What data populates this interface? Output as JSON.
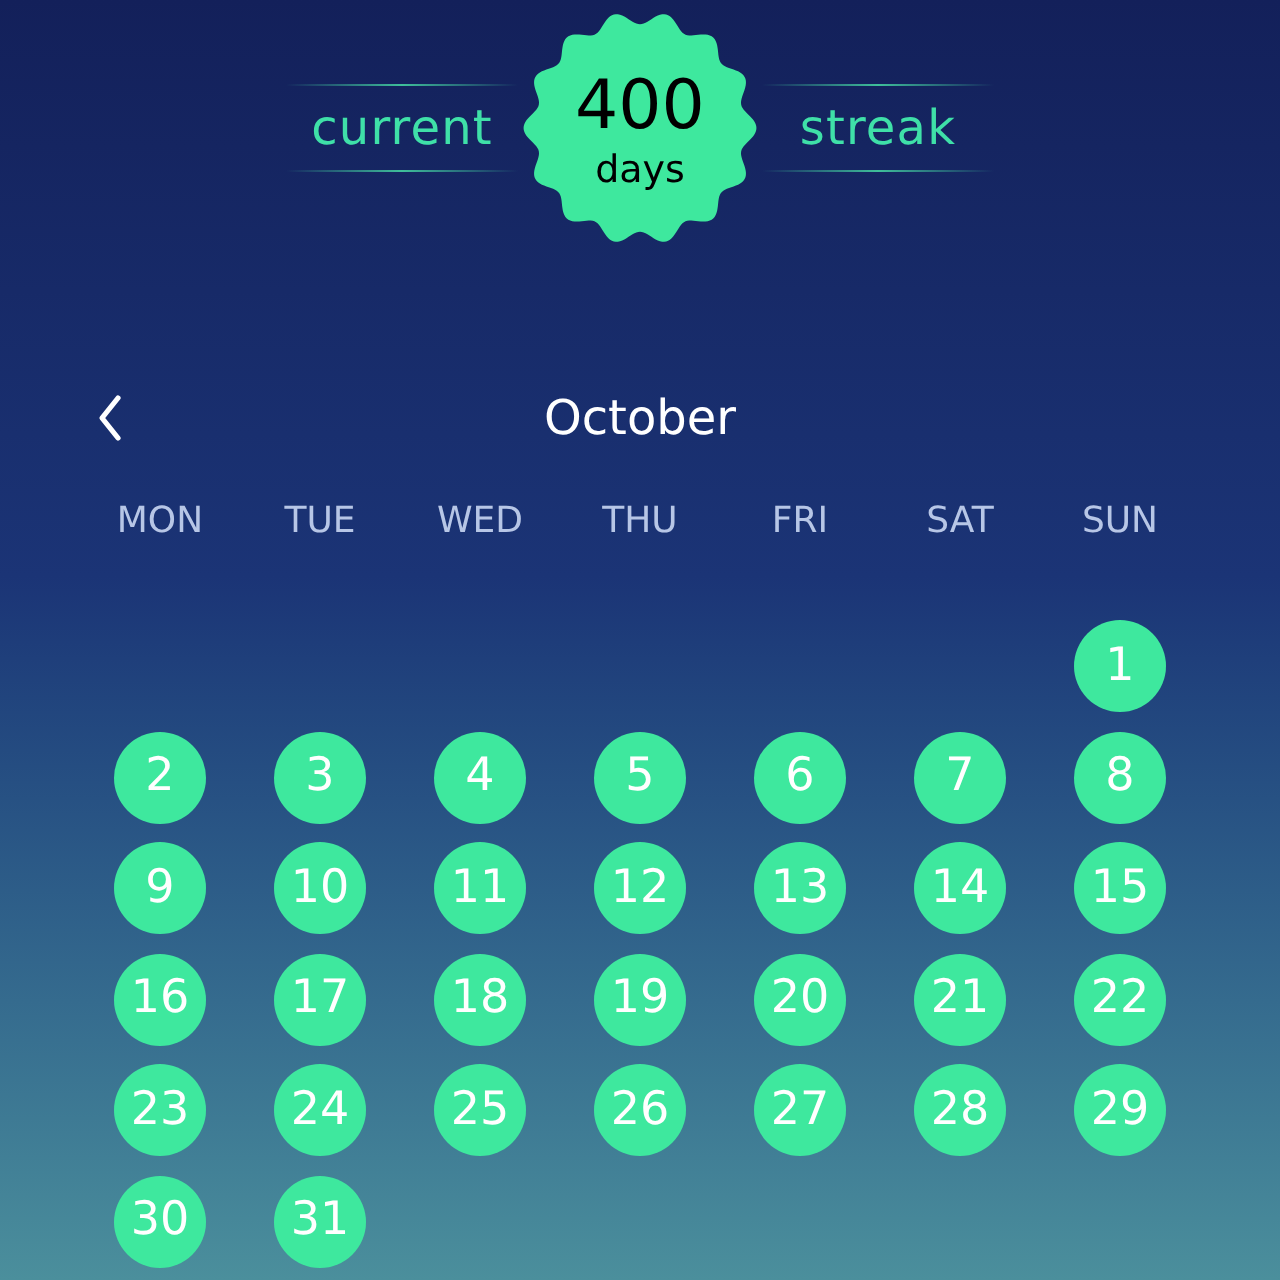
{
  "streak": {
    "left_label": "current",
    "count": "400",
    "unit": "days",
    "right_label": "streak"
  },
  "calendar": {
    "month": "October",
    "weekdays": [
      "MON",
      "TUE",
      "WED",
      "THU",
      "FRI",
      "SAT",
      "SUN"
    ],
    "weeks": [
      {
        "days": [
          {
            "label": "1",
            "completed": true
          }
        ]
      },
      {
        "days": [
          {
            "label": "2",
            "completed": true
          },
          {
            "label": "3",
            "completed": true
          },
          {
            "label": "4",
            "completed": true
          },
          {
            "label": "5",
            "completed": true
          },
          {
            "label": "6",
            "completed": true
          },
          {
            "label": "7",
            "completed": true
          },
          {
            "label": "8",
            "completed": true
          }
        ]
      },
      {
        "days": [
          {
            "label": "9",
            "completed": true
          },
          {
            "label": "10",
            "completed": true
          },
          {
            "label": "11",
            "completed": true
          },
          {
            "label": "12",
            "completed": true
          },
          {
            "label": "13",
            "completed": true
          },
          {
            "label": "14",
            "completed": true
          },
          {
            "label": "15",
            "completed": true
          }
        ]
      },
      {
        "days": [
          {
            "label": "16",
            "completed": true
          },
          {
            "label": "17",
            "completed": true
          },
          {
            "label": "18",
            "completed": true
          },
          {
            "label": "19",
            "completed": true
          },
          {
            "label": "20",
            "completed": true
          },
          {
            "label": "21",
            "completed": true
          },
          {
            "label": "22",
            "completed": true
          }
        ]
      },
      {
        "days": [
          {
            "label": "23",
            "completed": true
          },
          {
            "label": "24",
            "completed": true
          },
          {
            "label": "25",
            "completed": true
          },
          {
            "label": "26",
            "completed": true
          },
          {
            "label": "27",
            "completed": true
          },
          {
            "label": "28",
            "completed": true
          },
          {
            "label": "29",
            "completed": true
          }
        ]
      },
      {
        "days": [
          {
            "label": "30",
            "completed": true
          },
          {
            "label": "31",
            "completed": true
          }
        ]
      }
    ]
  }
}
